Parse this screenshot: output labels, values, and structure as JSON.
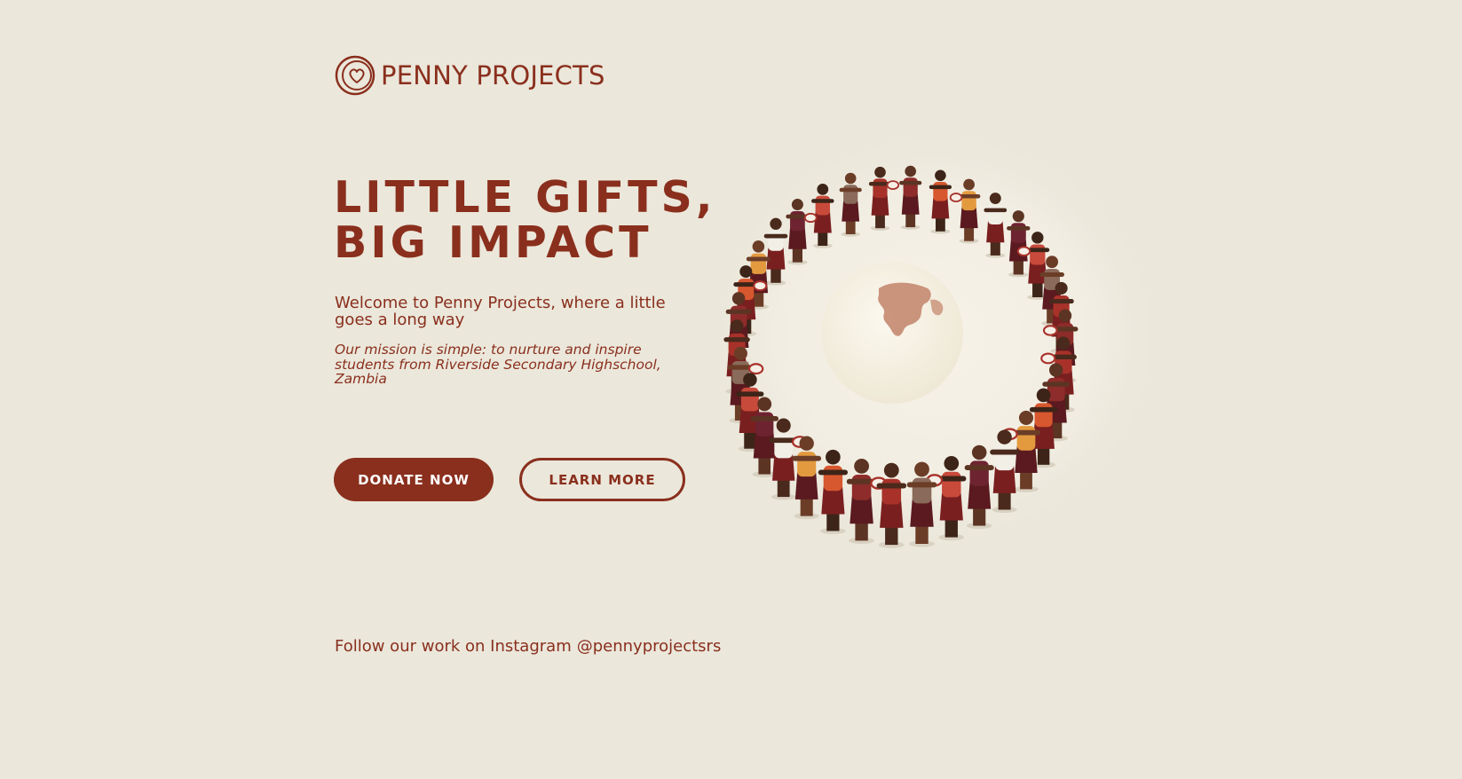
{
  "brand": {
    "name": "PENNY PROJECTS",
    "icon": "heart-coin-icon"
  },
  "hero": {
    "headline_line1": "LITTLE GIFTS,",
    "headline_line2": "BIG IMPACT",
    "subtitle": "Welcome to Penny Projects, where a little goes a long way",
    "mission": "Our mission is simple: to nurture and inspire students from Riverside Secondary Highschool, Zambia"
  },
  "actions": {
    "donate_label": "DONATE NOW",
    "learn_label": "LEARN MORE"
  },
  "social": {
    "follow_text": "Follow our work on Instagram",
    "handle": "@pennyprojectsrs"
  },
  "colors": {
    "background": "#ebe7db",
    "brand": "#8a2f1d",
    "button_text": "#ffffff"
  },
  "illustration": {
    "subject": "people-circle-around-globe"
  }
}
